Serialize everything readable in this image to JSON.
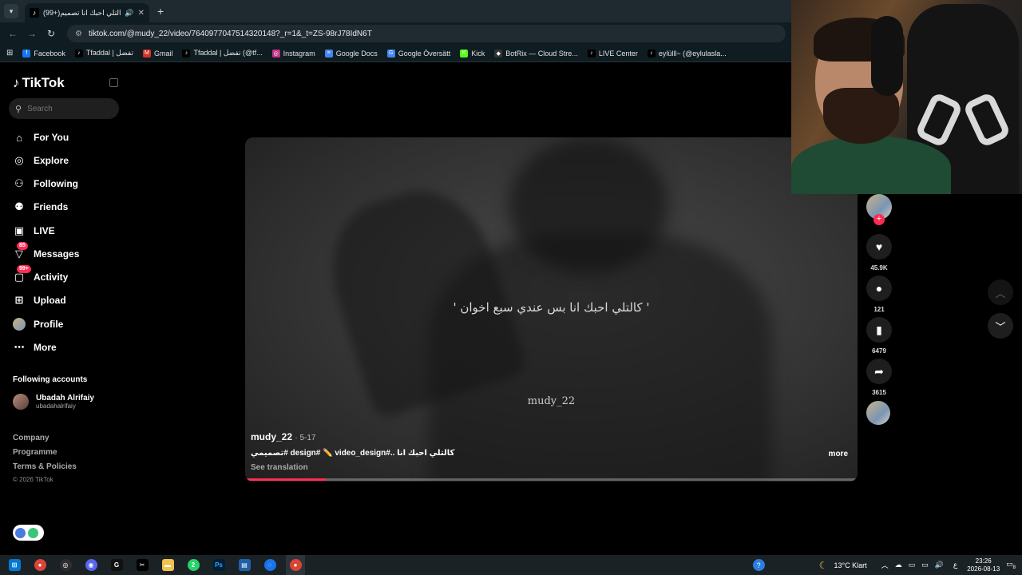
{
  "browser": {
    "tab_title": "(99+)كالتلي احبك انا تصميم",
    "url": "tiktok.com/@mudy_22/video/7640977047514320148?_r=1&_t=ZS-98rJ78IdN6T",
    "bookmarks": [
      {
        "label": "Facebook",
        "color": "#1877f2",
        "glyph": "f"
      },
      {
        "label": "Tfaddal | تفضل",
        "color": "#000000",
        "glyph": "♪"
      },
      {
        "label": "Gmail",
        "color": "#d93025",
        "glyph": "M"
      },
      {
        "label": "Tfaddal | تفضل (@tf...",
        "color": "#000000",
        "glyph": "♪"
      },
      {
        "label": "Instagram",
        "color": "#c13584",
        "glyph": "◎"
      },
      {
        "label": "Google Docs",
        "color": "#4285f4",
        "glyph": "≡"
      },
      {
        "label": "Google Översätt",
        "color": "#4285f4",
        "glyph": "G"
      },
      {
        "label": "Kick",
        "color": "#53fc18",
        "glyph": "K"
      },
      {
        "label": "BotRix — Cloud Stre...",
        "color": "#333333",
        "glyph": "◆"
      },
      {
        "label": "LIVE Center",
        "color": "#000000",
        "glyph": "♪"
      },
      {
        "label": "eylülll~ (@eylulasla...",
        "color": "#000000",
        "glyph": "♪"
      }
    ]
  },
  "tiktok": {
    "logo": "TikTok",
    "search_placeholder": "Search",
    "menu": [
      {
        "label": "For You",
        "icon": "home-icon",
        "glyph": "⌂"
      },
      {
        "label": "Explore",
        "icon": "compass-icon",
        "glyph": "◎"
      },
      {
        "label": "Following",
        "icon": "following-icon",
        "glyph": "⚇"
      },
      {
        "label": "Friends",
        "icon": "friends-icon",
        "glyph": "⚉"
      },
      {
        "label": "LIVE",
        "icon": "live-icon",
        "glyph": "▣"
      },
      {
        "label": "Messages",
        "icon": "messages-icon",
        "glyph": "▽",
        "badge": "85"
      },
      {
        "label": "Activity",
        "icon": "activity-icon",
        "glyph": "▢",
        "badge": "99+"
      },
      {
        "label": "Upload",
        "icon": "upload-icon",
        "glyph": "⊞"
      },
      {
        "label": "Profile",
        "icon": "profile-avatar",
        "glyph": "●"
      },
      {
        "label": "More",
        "icon": "more-icon",
        "glyph": "⋯"
      }
    ],
    "following_title": "Following accounts",
    "following_accounts": [
      {
        "name": "Ubadah Alrifaiy",
        "handle": "ubadahalrifaiy"
      }
    ],
    "footer": {
      "company": "Company",
      "programme": "Programme",
      "terms": "Terms & Policies",
      "copyright": "© 2026 TikTok"
    }
  },
  "video": {
    "caption": "' كالتلي احبك انا بس عندي سبع اخوان '",
    "watermark": "mudy_22",
    "author": "mudy_22",
    "date": "· 5-17",
    "description": "تصميمي# design# ✏️ video_design#.. كالتلي احبك انا",
    "more": "more",
    "see_translation": "See translation",
    "progress_percent": 13
  },
  "actions": {
    "likes": "45.9K",
    "comments": "121",
    "saves": "6479",
    "shares": "3615"
  },
  "taskbar": {
    "weather": "13°C  Klart",
    "time": "23:26",
    "date": "2026-08-13",
    "notifications": "8",
    "lang": "ع",
    "whatsapp_badge": "2"
  },
  "colors": {
    "accent": "#fe2c55"
  }
}
